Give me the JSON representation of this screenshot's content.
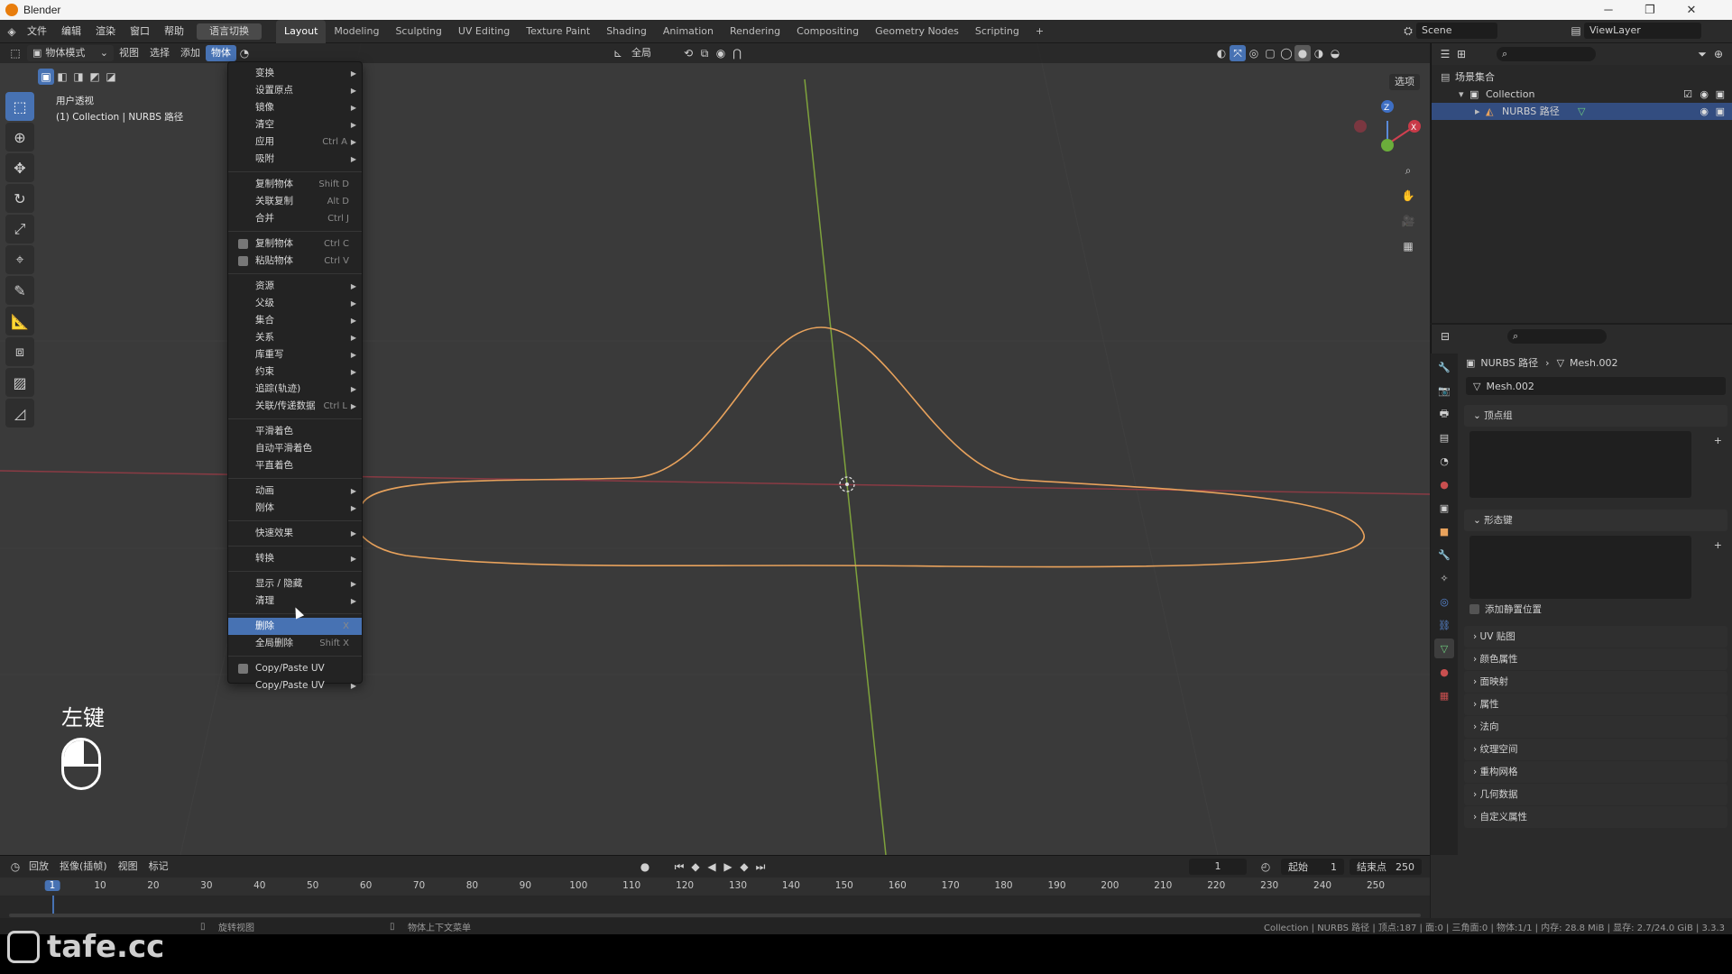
{
  "titlebar": {
    "title": "Blender",
    "minimize": "─",
    "maximize": "❐",
    "close": "✕"
  },
  "menu": {
    "file": "文件",
    "edit": "编辑",
    "render": "渲染",
    "window": "窗口",
    "help": "帮助",
    "lang": "语言切换"
  },
  "workspaces": [
    "Layout",
    "Modeling",
    "Sculpting",
    "UV Editing",
    "Texture Paint",
    "Shading",
    "Animation",
    "Rendering",
    "Compositing",
    "Geometry Nodes",
    "Scripting",
    "+"
  ],
  "scene": {
    "label": "Scene",
    "viewlayer": "ViewLayer"
  },
  "viewport": {
    "mode": "物体模式",
    "view": "视图",
    "select": "选择",
    "add": "添加",
    "object": "物体",
    "global": "全局",
    "options": "选项",
    "info_title": "用户透视",
    "info_sub": "(1) Collection | NURBS 路径",
    "mouse_label": "左键"
  },
  "context_menu": [
    {
      "label": "变换",
      "arrow": "▶"
    },
    {
      "label": "设置原点",
      "arrow": "▶"
    },
    {
      "label": "镜像",
      "arrow": "▶"
    },
    {
      "label": "清空",
      "arrow": "▶"
    },
    {
      "label": "应用",
      "shortcut": "Ctrl A",
      "arrow": "▶"
    },
    {
      "label": "吸附",
      "arrow": "▶"
    },
    {
      "sep": true
    },
    {
      "label": "复制物体",
      "shortcut": "Shift D"
    },
    {
      "label": "关联复制",
      "shortcut": "Alt D"
    },
    {
      "label": "合并",
      "shortcut": "Ctrl J"
    },
    {
      "sep": true
    },
    {
      "label": "复制物体",
      "shortcut": "Ctrl C",
      "icon": true
    },
    {
      "label": "粘贴物体",
      "shortcut": "Ctrl V",
      "icon": true
    },
    {
      "sep": true
    },
    {
      "label": "资源",
      "arrow": "▶"
    },
    {
      "label": "父级",
      "arrow": "▶"
    },
    {
      "label": "集合",
      "arrow": "▶"
    },
    {
      "label": "关系",
      "arrow": "▶"
    },
    {
      "label": "库重写",
      "arrow": "▶"
    },
    {
      "label": "约束",
      "arrow": "▶"
    },
    {
      "label": "追踪(轨迹)",
      "arrow": "▶"
    },
    {
      "label": "关联/传递数据",
      "shortcut": "Ctrl L",
      "arrow": "▶"
    },
    {
      "sep": true
    },
    {
      "label": "平滑着色"
    },
    {
      "label": "自动平滑着色"
    },
    {
      "label": "平直着色"
    },
    {
      "sep": true
    },
    {
      "label": "动画",
      "arrow": "▶"
    },
    {
      "label": "刚体",
      "arrow": "▶"
    },
    {
      "sep": true
    },
    {
      "label": "快速效果",
      "arrow": "▶"
    },
    {
      "sep": true
    },
    {
      "label": "转换",
      "arrow": "▶"
    },
    {
      "sep": true
    },
    {
      "label": "显示 / 隐藏",
      "arrow": "▶"
    },
    {
      "label": "清理",
      "arrow": "▶"
    },
    {
      "sep": true
    },
    {
      "label": "删除",
      "shortcut": "X",
      "highlight": true
    },
    {
      "label": "全局删除",
      "shortcut": "Shift X"
    },
    {
      "sep": true
    },
    {
      "label": "Copy/Paste UV",
      "icon": true
    },
    {
      "label": "Copy/Paste UV",
      "arrow": "▶"
    }
  ],
  "outliner": {
    "root": "场景集合",
    "collection": "Collection",
    "object": "NURBS 路径"
  },
  "properties": {
    "breadcrumb_obj": "NURBS 路径",
    "breadcrumb_mesh": "Mesh.002",
    "mesh_name": "Mesh.002",
    "vertex_groups": "顶点组",
    "shape_keys": "形态键",
    "add_rest": "添加静置位置",
    "panels": [
      "UV 贴图",
      "颜色属性",
      "面映射",
      "属性",
      "法向",
      "纹理空间",
      "重构网格",
      "几何数据",
      "自定义属性"
    ]
  },
  "timeline": {
    "playback": "回放",
    "keying": "抠像(插帧)",
    "view": "视图",
    "marker": "标记",
    "current_frame": "1",
    "start_label": "起始",
    "start": "1",
    "end_label": "结束点",
    "end": "250",
    "ticks": [
      "1",
      "10",
      "20",
      "30",
      "40",
      "50",
      "60",
      "70",
      "80",
      "90",
      "100",
      "110",
      "120",
      "130",
      "140",
      "150",
      "160",
      "170",
      "180",
      "190",
      "200",
      "210",
      "220",
      "230",
      "240",
      "250"
    ]
  },
  "statusbar": {
    "left1": "旋转视图",
    "left2": "物体上下文菜单",
    "right": "Collection | NURBS 路径 | 顶点:187 | 面:0 | 三角面:0 | 物体:1/1 | 内存: 28.8 MiB | 显存: 2.7/24.0 GiB | 3.3.3"
  },
  "watermark": "tafe.cc",
  "colors": {
    "accent": "#4772b3",
    "curve": "#e8a25c",
    "x_axis": "#8a3b44",
    "y_axis": "#7ea23c"
  }
}
